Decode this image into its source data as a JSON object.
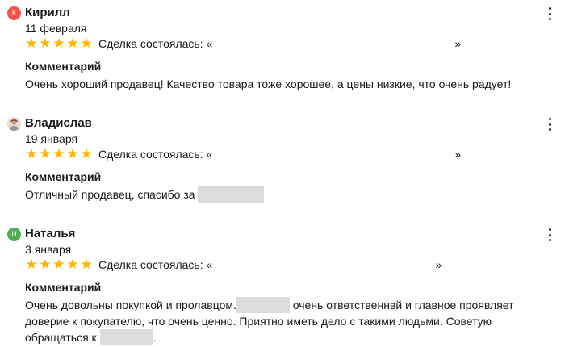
{
  "reviews": [
    {
      "author": "Кирилл",
      "avatar_initial": "К",
      "avatar_color": "#f2544b",
      "date": "11 февраля",
      "rating": 5,
      "deal_label": "Сделка состоялась:",
      "deal_open": "«",
      "deal_close": "»",
      "comment_title": "Комментарий",
      "comment": "Очень хороший продавец! Качество товара тоже хорошее, а цены низкие, что очень радует!"
    },
    {
      "author": "Владислав",
      "avatar_icon": "user-photo-icon",
      "date": "19 января",
      "rating": 5,
      "deal_label": "Сделка состоялась:",
      "deal_open": "«",
      "deal_close": "»",
      "comment_title": "Комментарий",
      "comment_part1": "Отличный продавец, спасибо за "
    },
    {
      "author": "Наталья",
      "avatar_initial": "Н",
      "avatar_color": "#4caf50",
      "date": "3 января",
      "rating": 5,
      "deal_label": "Сделка состоялась:",
      "deal_open": "«",
      "deal_close": "»",
      "comment_title": "Комментарий",
      "comment_part1": "Очень довольны покупкой и пролавцом.",
      "comment_part2": " очень ответственнвй и главное проявляет доверие к покупателю, что очень ценно. Приятно иметь дело с такими людьми. Советую обращаться к ",
      "comment_part3": "."
    }
  ],
  "icons": {
    "star": "star-icon",
    "more": "more-vertical-icon"
  },
  "colors": {
    "star": "#ffb400",
    "redaction": "#dcdcdc"
  }
}
